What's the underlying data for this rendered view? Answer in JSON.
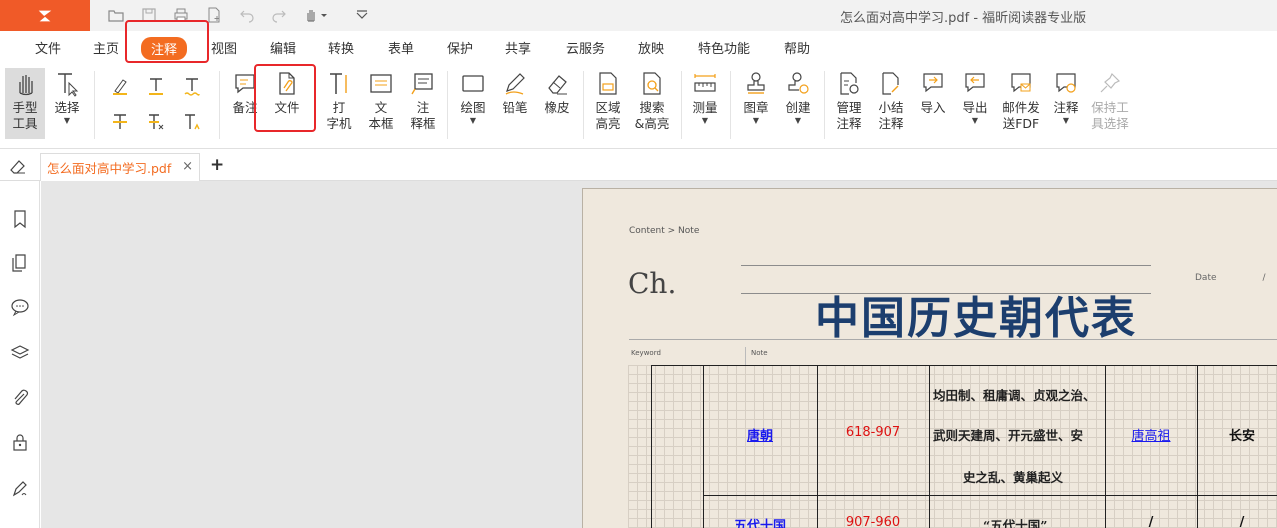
{
  "window": {
    "title": "怎么面对高中学习.pdf - 福昕阅读器专业版"
  },
  "menu": [
    {
      "label": "文件"
    },
    {
      "label": "主页"
    },
    {
      "label": "注释"
    },
    {
      "label": "视图"
    },
    {
      "label": "编辑"
    },
    {
      "label": "转换"
    },
    {
      "label": "表单"
    },
    {
      "label": "保护"
    },
    {
      "label": "共享"
    },
    {
      "label": "云服务"
    },
    {
      "label": "放映"
    },
    {
      "label": "特色功能"
    },
    {
      "label": "帮助"
    }
  ],
  "ribbon": {
    "hand_tool": [
      "手型",
      "工具"
    ],
    "select": "选择",
    "note": "备注",
    "file": "文件",
    "typewriter": [
      "打",
      "字机"
    ],
    "textbox": [
      "文",
      "本框"
    ],
    "callout": [
      "注",
      "释框"
    ],
    "draw": "绘图",
    "pencil": "铅笔",
    "eraser": "橡皮",
    "area_highlight": [
      "区域",
      "高亮"
    ],
    "search_highlight": [
      "搜索",
      "&高亮"
    ],
    "measure": "测量",
    "stamp": "图章",
    "create": "创建",
    "manage": [
      "管理",
      "注释"
    ],
    "summary": [
      "小结",
      "注释"
    ],
    "import": "导入",
    "export": "导出",
    "email_fdf": [
      "邮件发",
      "送FDF"
    ],
    "annotations": "注释",
    "keep_tool": [
      "保持工",
      "具选择"
    ]
  },
  "tab": {
    "filename": "怎么面对高中学习.pdf",
    "close": "×",
    "new": "+"
  },
  "page": {
    "breadcrumb": "Content > Note",
    "chapter": "Ch.",
    "date_label": "Date",
    "date_sep": "/",
    "title": "中国历史朝代表",
    "col_keyword": "Keyword",
    "col_note": "Note",
    "rows": [
      {
        "dynasty": "唐朝",
        "years": "618-907",
        "desc": [
          "均田制、租庸调、贞观之治、",
          "武则天建周、开元盛世、安",
          "史之乱、黄巢起义"
        ],
        "founder": "唐高祖",
        "capital": "长安"
      },
      {
        "dynasty": "五代十国",
        "years": "907-960",
        "desc": [
          "“五代十国”"
        ],
        "founder": "/",
        "capital": "/"
      }
    ]
  }
}
